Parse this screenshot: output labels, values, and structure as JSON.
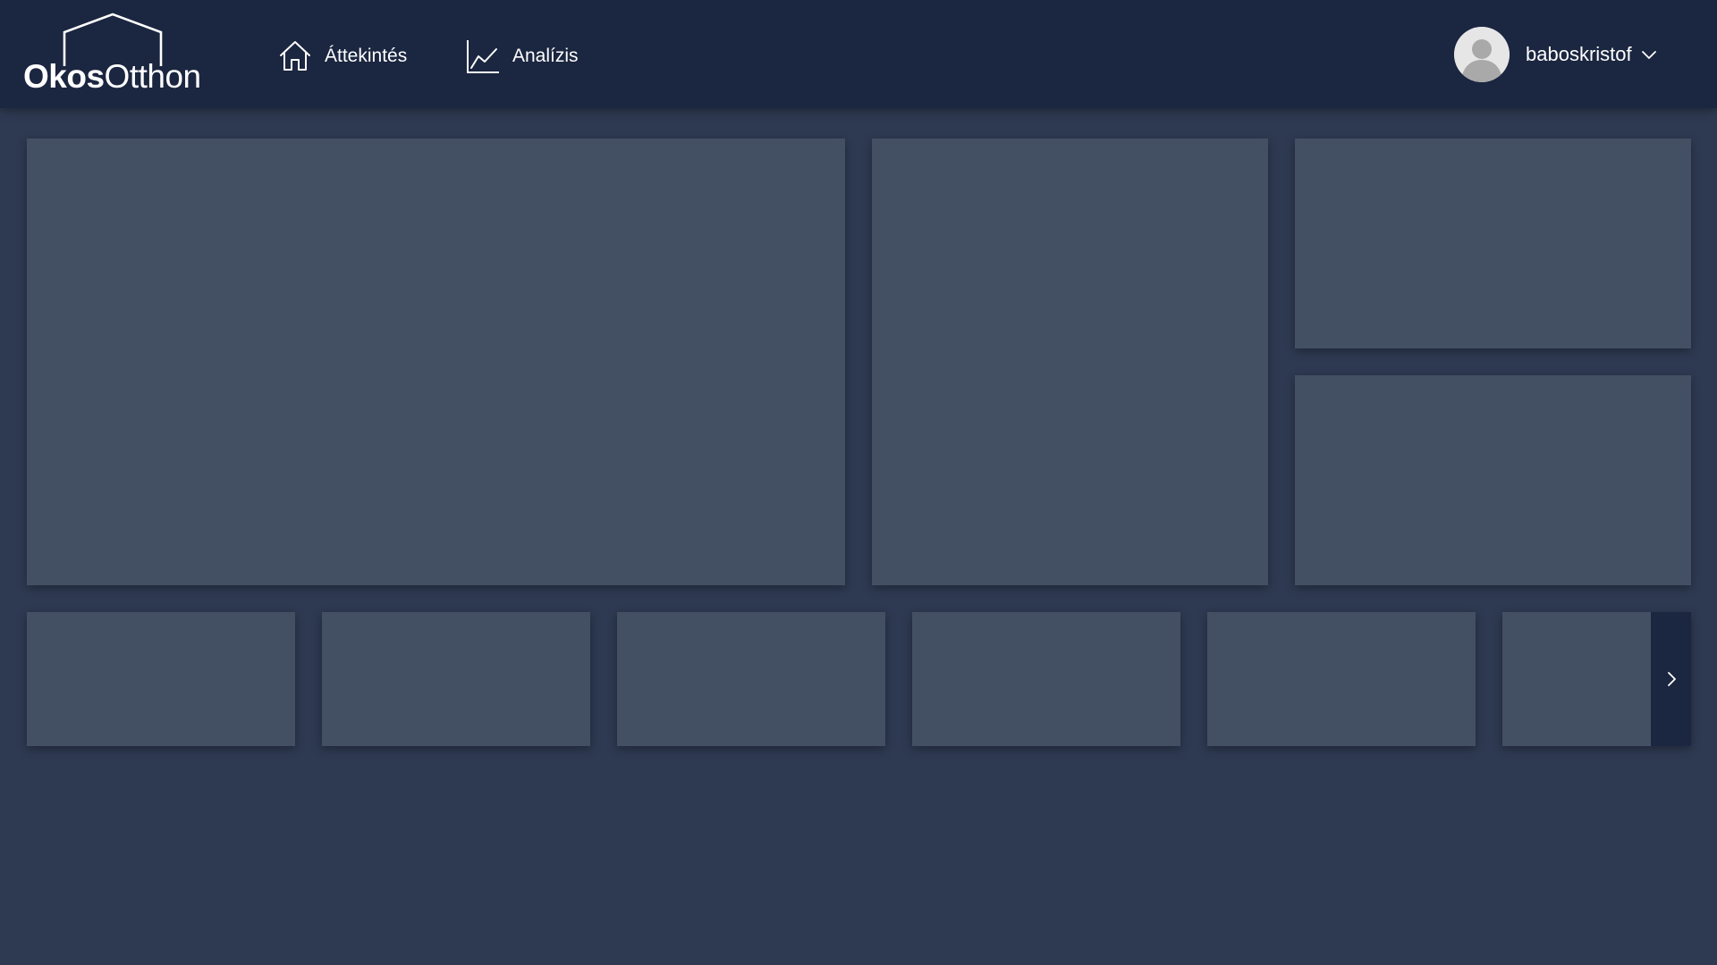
{
  "header": {
    "logo": {
      "part_bold": "Okos",
      "part_thin": "Otthon"
    },
    "nav": [
      {
        "label": "Áttekintés",
        "icon": "home-icon",
        "active": true
      },
      {
        "label": "Analízis",
        "icon": "line-chart-icon",
        "active": false
      }
    ],
    "user": {
      "name": "baboskristof",
      "avatar_icon": "user-avatar-icon",
      "dropdown_icon": "chevron-down-icon"
    }
  },
  "dashboard": {
    "tile_carousel": {
      "next_icon": "chevron-right-icon"
    }
  },
  "colors": {
    "header_bg": "#1b2640",
    "page_bg": "#2e3a52",
    "card_bg": "#434f63",
    "text": "#ffffff"
  }
}
